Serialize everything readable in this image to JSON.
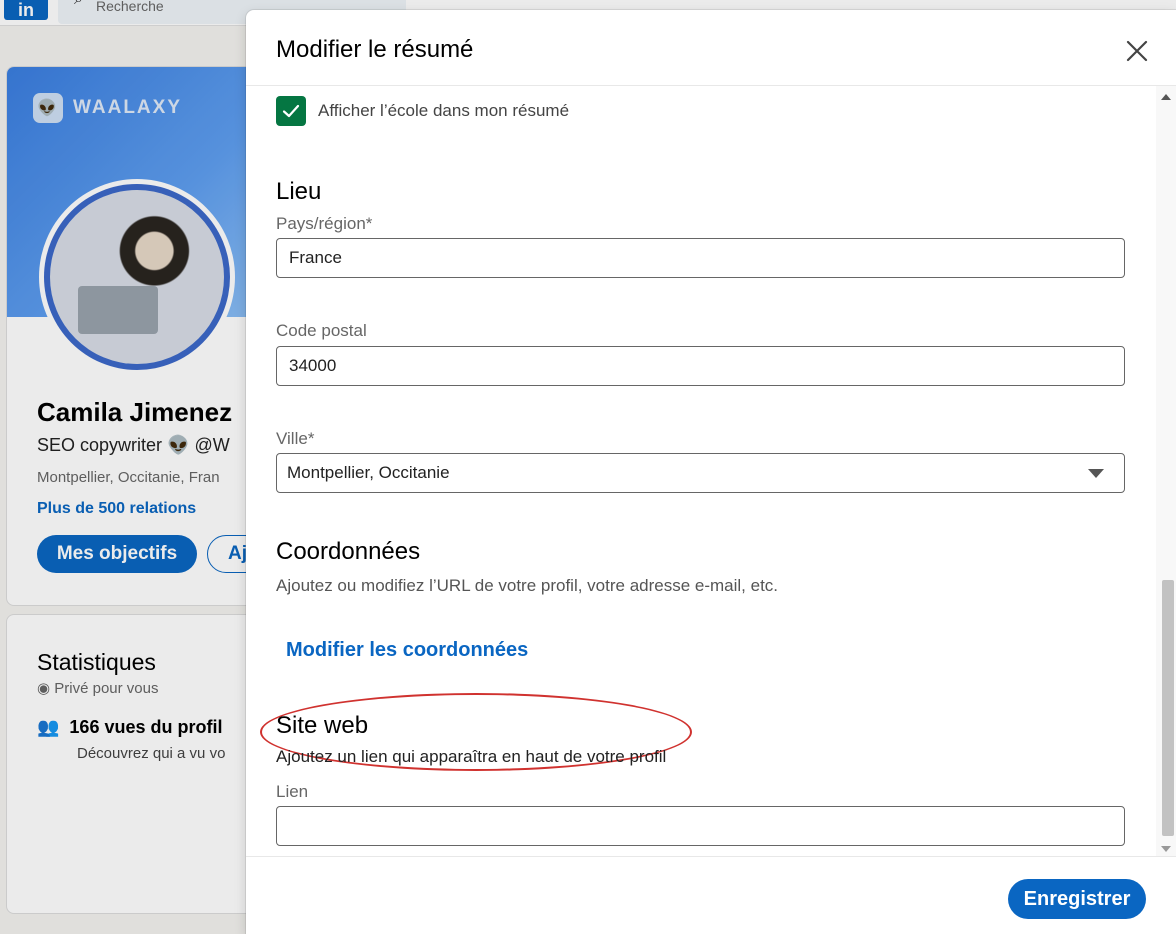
{
  "background": {
    "logo": "in",
    "search_placeholder": "Recherche",
    "brand": "WAALAXY",
    "profile": {
      "name": "Camila Jimenez",
      "headline": "SEO copywriter 👽 @W",
      "location": "Montpellier, Occitanie, Fran",
      "relations": "Plus de 500 relations",
      "goals_button": "Mes objectifs",
      "add_button": "Aj"
    },
    "stats": {
      "title": "Statistiques",
      "private": "Privé pour vous",
      "views": "166 vues du profil",
      "views_sub": "Découvrez qui a vu vo"
    }
  },
  "modal": {
    "title": "Modifier le résumé",
    "show_school_label": "Afficher l’école dans mon résumé",
    "show_school_checked": true,
    "location": {
      "title": "Lieu",
      "country_label": "Pays/région*",
      "country_value": "France",
      "postal_label": "Code postal",
      "postal_value": "34000",
      "city_label": "Ville*",
      "city_value": "Montpellier, Occitanie"
    },
    "contact": {
      "title": "Coordonnées",
      "description": "Ajoutez ou modifiez l’URL de votre profil, votre adresse e-mail, etc.",
      "edit_link": "Modifier les coordonnées"
    },
    "website": {
      "title": "Site web",
      "description": "Ajoutez un lien qui apparaîtra en haut de votre profil",
      "link_label": "Lien",
      "link_value": ""
    },
    "save_button": "Enregistrer"
  },
  "colors": {
    "brand_blue": "#0a66c2",
    "checkbox_green": "#057642",
    "highlight_red": "#d0322f"
  }
}
